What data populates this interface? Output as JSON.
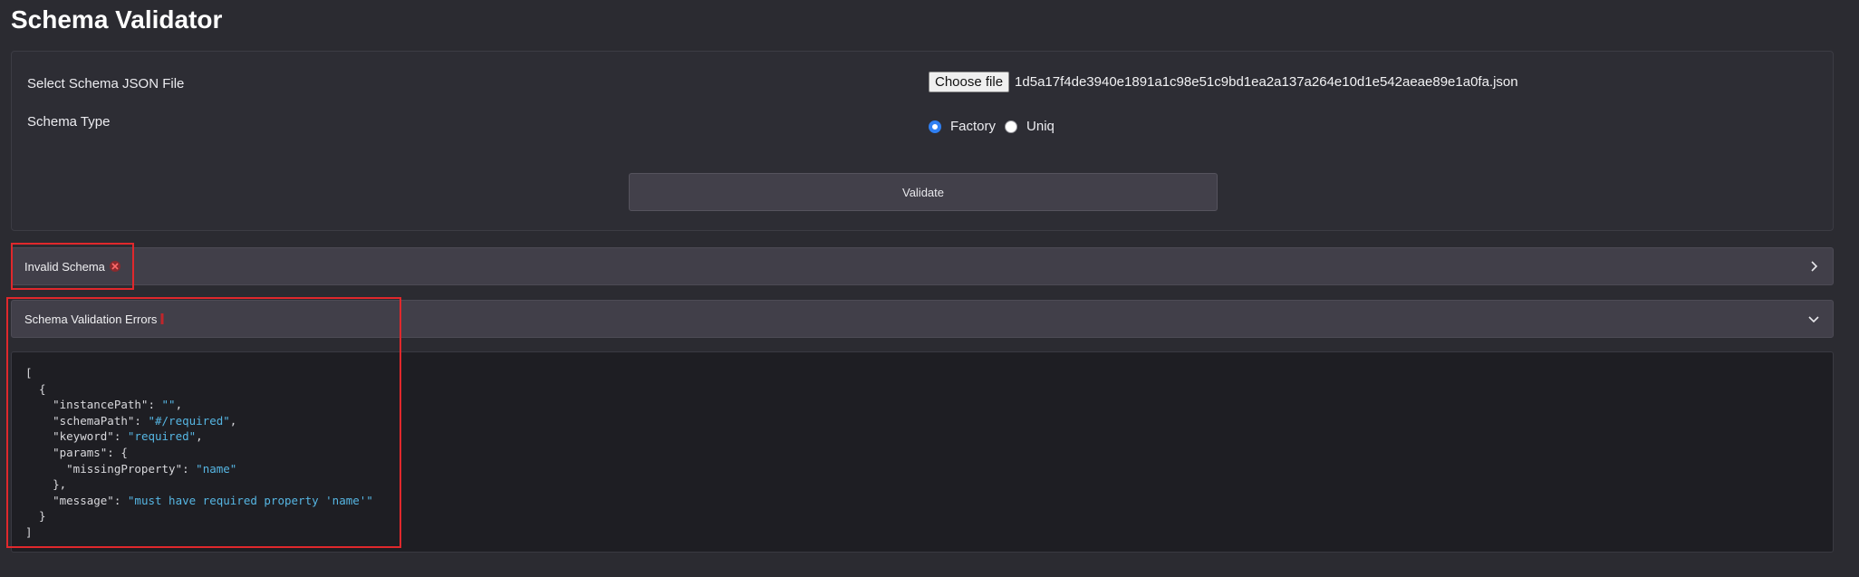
{
  "page": {
    "title": "Schema Validator"
  },
  "form": {
    "file_label": "Select Schema JSON File",
    "choose_file_label": "Choose file",
    "file_name": "1d5a17f4de3940e1891a1c98e51c9bd1ea2a137a264e10d1e542aeae89e1a0fa.json",
    "schema_type_label": "Schema Type",
    "schema_type_options": [
      {
        "label": "Factory",
        "checked": true
      },
      {
        "label": "Uniq",
        "checked": false
      }
    ],
    "validate_label": "Validate"
  },
  "status_accordion": {
    "label": "Invalid Schema",
    "icon": "x-icon",
    "status_color": "#e0282c",
    "expanded": false
  },
  "errors_accordion": {
    "label": "Schema Validation Errors",
    "icon": "exclamation-icon",
    "expanded": true
  },
  "errors_json": {
    "instancePath": "",
    "schemaPath": "#/required",
    "keyword": "required",
    "missingProperty": "name",
    "message": "must have required property 'name'"
  },
  "colors": {
    "background": "#2b2b31",
    "accent": "#2f7ff2",
    "string": "#56b6e3",
    "highlight": "#e0282c"
  }
}
